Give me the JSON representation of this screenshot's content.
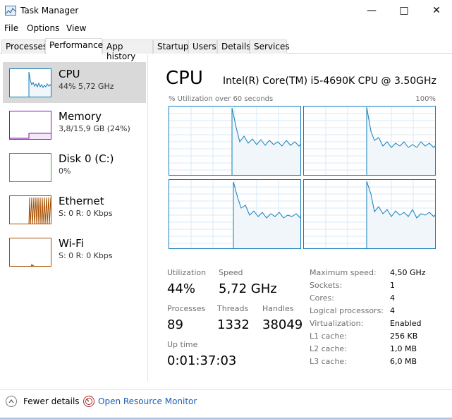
{
  "window": {
    "title": "Task Manager",
    "minimize_glyph": "—",
    "maximize_glyph": "□",
    "close_glyph": "✕"
  },
  "menu": {
    "file": "File",
    "options": "Options",
    "view": "View"
  },
  "tabs": [
    {
      "label": "Processes"
    },
    {
      "label": "Performance",
      "active": true
    },
    {
      "label": "App history"
    },
    {
      "label": "Startup"
    },
    {
      "label": "Users"
    },
    {
      "label": "Details"
    },
    {
      "label": "Services"
    }
  ],
  "sidebar": {
    "items": [
      {
        "title": "CPU",
        "sub": "44% 5,72 GHz",
        "color": "#117dbb",
        "selected": true
      },
      {
        "title": "Memory",
        "sub": "3,8/15,9 GB (24%)",
        "color": "#8b12ae"
      },
      {
        "title": "Disk 0 (C:)",
        "sub": "0%",
        "color": "#4da60c"
      },
      {
        "title": "Ethernet",
        "sub": "S: 0 R: 0 Kbps",
        "color": "#a74f01"
      },
      {
        "title": "Wi-Fi",
        "sub": "S: 0 R: 0 Kbps",
        "color": "#a74f01"
      }
    ]
  },
  "main": {
    "title": "CPU",
    "cpu_name": "Intel(R) Core(TM) i5-4690K CPU @ 3.50GHz",
    "graph_caption": "% Utilization over 60 seconds",
    "graph_max": "100%",
    "stats": {
      "utilization_label": "Utilization",
      "utilization_value": "44%",
      "speed_label": "Speed",
      "speed_value": "5,72 GHz",
      "processes_label": "Processes",
      "processes_value": "89",
      "threads_label": "Threads",
      "threads_value": "1332",
      "handles_label": "Handles",
      "handles_value": "38049",
      "uptime_label": "Up time",
      "uptime_value": "0:01:37:03"
    },
    "specs": [
      {
        "label": "Maximum speed:",
        "value": "4,50 GHz"
      },
      {
        "label": "Sockets:",
        "value": "1"
      },
      {
        "label": "Cores:",
        "value": "4"
      },
      {
        "label": "Logical processors:",
        "value": "4"
      },
      {
        "label": "Virtualization:",
        "value": "Enabled"
      },
      {
        "label": "L1 cache:",
        "value": "256 KB"
      },
      {
        "label": "L2 cache:",
        "value": "1,0 MB"
      },
      {
        "label": "L3 cache:",
        "value": "6,0 MB"
      }
    ]
  },
  "footer": {
    "fewer_details": "Fewer details",
    "open_resource_monitor": "Open Resource Monitor"
  },
  "colors": {
    "cpu_line": "#117dbb",
    "cpu_fill": "#f1f6fa",
    "link": "#1a5fb4"
  }
}
